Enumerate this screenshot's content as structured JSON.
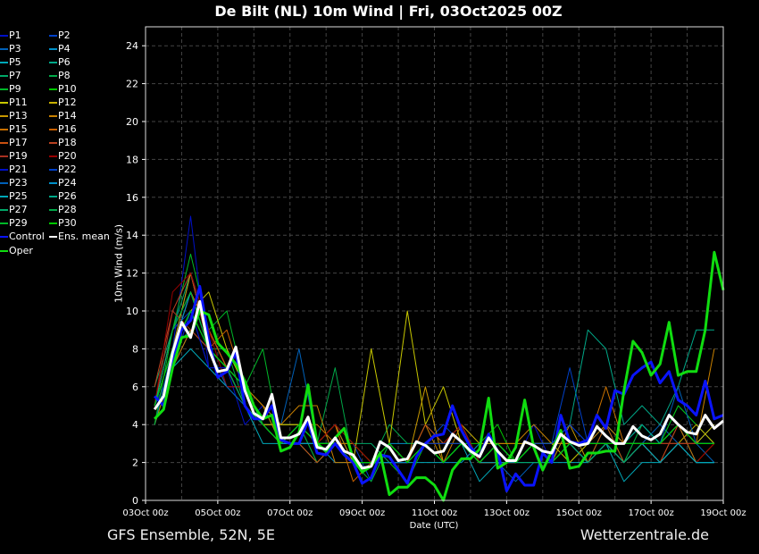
{
  "chart_data": {
    "type": "line",
    "title": "De Bilt  (NL)  10m Wind | Fri, 03Oct2025 00Z",
    "xlabel": "Date (UTC)",
    "ylabel": "10m Wind (m/s)",
    "ylim": [
      0,
      25
    ],
    "yticks": [
      "0",
      "2",
      "4",
      "6",
      "8",
      "10",
      "12",
      "14",
      "16",
      "18",
      "20",
      "22",
      "24"
    ],
    "xlim_hours": [
      0,
      384
    ],
    "xticks": [
      "03Oct 00z",
      "05Oct 00z",
      "07Oct 00z",
      "09Oct 00z",
      "11Oct 00z",
      "13Oct 00z",
      "15Oct 00z",
      "17Oct 00z",
      "19Oct 00z"
    ],
    "grid": true,
    "legend_position": "left-outside",
    "step_hours_main": 6,
    "step_hours_members": 12,
    "highlight_series": [
      {
        "name": "Control",
        "color": "#0a14ff",
        "values": [
          5.5,
          5.0,
          7.5,
          9.0,
          9.5,
          11.3,
          8.5,
          6.5,
          6.8,
          7.8,
          5.0,
          4.3,
          4.3,
          5.0,
          3.2,
          3.0,
          3.0,
          4.2,
          2.5,
          2.4,
          3.0,
          2.4,
          2.0,
          0.9,
          1.2,
          2.4,
          2.3,
          1.6,
          0.9,
          2.3,
          3.0,
          3.4,
          3.5,
          5.0,
          3.7,
          2.8,
          2.3,
          3.5,
          2.6,
          0.5,
          1.4,
          0.8,
          0.8,
          2.5,
          2.0,
          4.5,
          3.1,
          3.0,
          3.2,
          4.5,
          3.8,
          5.8,
          5.6,
          6.6,
          7.0,
          7.3,
          6.2,
          6.8,
          5.3,
          5.0,
          4.5,
          6.3,
          4.3,
          4.5
        ]
      },
      {
        "name": "Oper",
        "color": "#10dd10",
        "values": [
          4.3,
          4.8,
          7.0,
          8.6,
          8.7,
          10.0,
          9.8,
          8.3,
          7.8,
          7.2,
          6.3,
          5.0,
          4.3,
          4.5,
          2.6,
          2.8,
          3.6,
          6.1,
          3.0,
          2.6,
          3.3,
          3.8,
          2.2,
          1.5,
          1.8,
          2.5,
          0.3,
          0.7,
          0.7,
          1.2,
          1.2,
          0.8,
          0.0,
          1.6,
          2.2,
          2.2,
          2.7,
          5.4,
          1.7,
          2.0,
          2.8,
          5.3,
          2.8,
          1.6,
          2.6,
          3.7,
          1.7,
          1.8,
          2.5,
          2.5,
          2.6,
          2.6,
          5.8,
          8.4,
          7.8,
          6.6,
          7.2,
          9.4,
          6.6,
          6.8,
          6.8,
          9.0,
          13.1,
          11.1
        ]
      },
      {
        "name": "Ens. mean",
        "color": "#ffffff",
        "values": [
          4.8,
          5.5,
          7.8,
          9.4,
          8.6,
          10.5,
          8.0,
          6.8,
          6.9,
          8.1,
          5.8,
          4.6,
          4.3,
          5.6,
          3.3,
          3.3,
          3.5,
          4.4,
          2.8,
          2.7,
          3.3,
          2.6,
          2.4,
          1.7,
          1.8,
          3.1,
          2.8,
          2.1,
          2.2,
          3.1,
          2.9,
          2.5,
          2.6,
          3.5,
          3.1,
          2.6,
          2.3,
          3.3,
          2.6,
          2.1,
          2.1,
          3.1,
          2.9,
          2.6,
          2.5,
          3.5,
          3.1,
          2.9,
          3.0,
          3.9,
          3.4,
          3.0,
          3.0,
          3.9,
          3.4,
          3.2,
          3.5,
          4.5,
          4.0,
          3.6,
          3.5,
          4.5,
          3.8,
          4.2
        ]
      }
    ],
    "members": [
      {
        "name": "P1",
        "color": "#0010c8",
        "values": [
          5,
          8,
          15,
          7,
          7,
          4,
          5,
          3,
          4,
          3,
          4,
          2,
          2,
          3,
          2,
          3,
          3,
          4,
          2,
          3,
          2,
          4,
          2,
          4,
          3,
          3,
          2,
          3,
          3,
          4,
          3,
          4
        ]
      },
      {
        "name": "P2",
        "color": "#0040c8",
        "values": [
          5,
          9,
          10,
          7,
          6,
          6,
          4,
          3,
          4,
          2,
          3,
          3,
          1,
          3,
          2,
          3,
          4,
          3,
          2,
          2,
          2,
          3,
          3,
          7,
          3,
          3,
          2,
          4,
          3,
          5,
          4,
          3
        ]
      },
      {
        "name": "P3",
        "color": "#0060b8",
        "values": [
          4,
          7,
          9,
          8,
          7,
          5,
          4,
          4,
          8,
          3,
          3,
          2,
          2,
          2,
          2,
          4,
          3,
          4,
          2,
          2,
          1,
          2,
          2,
          3,
          2,
          4,
          2,
          3,
          4,
          3,
          3,
          2
        ]
      },
      {
        "name": "P4",
        "color": "#0090c8",
        "values": [
          5,
          8,
          12,
          9,
          7,
          6,
          4,
          3,
          4,
          3,
          2,
          2,
          2,
          3,
          3,
          3,
          2,
          2,
          3,
          3,
          2,
          3,
          2,
          3,
          3,
          4,
          3,
          4,
          3,
          4,
          2,
          2
        ]
      },
      {
        "name": "P5",
        "color": "#00a8b8",
        "values": [
          5,
          7,
          8,
          7,
          6,
          5,
          3,
          3,
          3,
          2,
          3,
          2,
          2,
          2,
          2,
          2,
          2,
          3,
          1,
          2,
          2,
          2,
          2,
          2,
          2,
          3,
          1,
          2,
          2,
          3,
          2,
          2
        ]
      },
      {
        "name": "P6",
        "color": "#00a888",
        "values": [
          5,
          8,
          9,
          8,
          7,
          6,
          4,
          4,
          4,
          3,
          3,
          2,
          2,
          3,
          2,
          3,
          2,
          3,
          2,
          3,
          2,
          3,
          3,
          4,
          9,
          8,
          4,
          5,
          4,
          6,
          9,
          9
        ]
      },
      {
        "name": "P7",
        "color": "#00a868",
        "values": [
          6,
          9,
          12,
          8,
          7,
          6,
          5,
          4,
          4,
          3,
          4,
          3,
          3,
          2,
          2,
          3,
          3,
          3,
          2,
          2,
          2,
          2,
          2,
          3,
          3,
          3,
          3,
          3,
          2,
          3,
          2,
          2
        ]
      },
      {
        "name": "P8",
        "color": "#00a848",
        "values": [
          4,
          7,
          10,
          8,
          8,
          5,
          4,
          3,
          3,
          3,
          7,
          2,
          2,
          4,
          3,
          3,
          2,
          3,
          2,
          2,
          2,
          3,
          2,
          3,
          2,
          3,
          2,
          3,
          3,
          4,
          3,
          3
        ]
      },
      {
        "name": "P9",
        "color": "#00b828",
        "values": [
          5,
          9,
          13,
          9,
          10,
          6,
          8,
          3,
          4,
          2,
          3,
          2,
          1,
          3,
          2,
          3,
          3,
          3,
          2,
          3,
          2,
          3,
          3,
          3,
          2,
          4,
          2,
          4,
          3,
          4,
          3,
          3
        ]
      },
      {
        "name": "P10",
        "color": "#00c800",
        "values": [
          4,
          8,
          11,
          8,
          7,
          6,
          5,
          3,
          3,
          3,
          3,
          3,
          2,
          2,
          1,
          3,
          2,
          3,
          3,
          4,
          2,
          3,
          2,
          3,
          3,
          3,
          3,
          4,
          3,
          5,
          4,
          3
        ]
      },
      {
        "name": "P11",
        "color": "#c8c800",
        "values": [
          5,
          8,
          10,
          11,
          8,
          6,
          4,
          4,
          4,
          3,
          3,
          2,
          8,
          3,
          10,
          4,
          6,
          3,
          2,
          2,
          2,
          3,
          3,
          2,
          3,
          3,
          3,
          3,
          2,
          3,
          3,
          4
        ]
      },
      {
        "name": "P12",
        "color": "#c8b000",
        "values": [
          5,
          8,
          11,
          9,
          7,
          5,
          4,
          4,
          4,
          3,
          3,
          2,
          2,
          3,
          2,
          3,
          3,
          4,
          3,
          3,
          3,
          3,
          3,
          3,
          3,
          3,
          3,
          3,
          3,
          3,
          4,
          3
        ]
      },
      {
        "name": "P13",
        "color": "#c89800",
        "values": [
          5,
          8,
          12,
          8,
          7,
          5,
          4,
          3,
          3,
          3,
          4,
          2,
          2,
          3,
          2,
          6,
          2,
          3,
          2,
          3,
          2,
          3,
          2,
          4,
          2,
          3,
          3,
          3,
          3,
          4,
          3,
          3
        ]
      },
      {
        "name": "P14",
        "color": "#c88000",
        "values": [
          4,
          7,
          9,
          8,
          7,
          6,
          5,
          4,
          5,
          5,
          2,
          2,
          2,
          2,
          2,
          4,
          2,
          4,
          2,
          3,
          3,
          4,
          3,
          3,
          3,
          4,
          3,
          3,
          3,
          4,
          3,
          8
        ]
      },
      {
        "name": "P15",
        "color": "#c87000",
        "values": [
          5,
          9,
          11,
          9,
          7,
          6,
          5,
          3,
          4,
          4,
          3,
          3,
          2,
          3,
          2,
          3,
          3,
          4,
          2,
          3,
          2,
          3,
          2,
          3,
          3,
          6,
          3,
          3,
          2,
          4,
          2,
          3
        ]
      },
      {
        "name": "P16",
        "color": "#c86000",
        "values": [
          5,
          8,
          10,
          8,
          9,
          6,
          4,
          3,
          4,
          3,
          4,
          1,
          2,
          3,
          2,
          3,
          2,
          3,
          2,
          3,
          2,
          3,
          2,
          3,
          2,
          3,
          2,
          3,
          3,
          3,
          3,
          3
        ]
      },
      {
        "name": "P17",
        "color": "#c85010",
        "values": [
          5,
          8,
          11,
          9,
          7,
          5,
          4,
          3,
          3,
          2,
          3,
          2,
          2,
          3,
          2,
          4,
          3,
          3,
          2,
          2,
          2,
          3,
          2,
          3,
          2,
          4,
          2,
          3,
          3,
          4,
          3,
          3
        ]
      },
      {
        "name": "P18",
        "color": "#b84020",
        "values": [
          6,
          10,
          12,
          8,
          6,
          6,
          4,
          3,
          4,
          3,
          3,
          2,
          2,
          3,
          2,
          3,
          2,
          3,
          2,
          3,
          2,
          3,
          2,
          3,
          3,
          3,
          3,
          3,
          2,
          4,
          3,
          3
        ]
      },
      {
        "name": "P19",
        "color": "#a83020",
        "values": [
          5,
          10,
          9,
          8,
          7,
          6,
          4,
          3,
          3,
          3,
          3,
          2,
          2,
          2,
          2,
          3,
          2,
          3,
          2,
          3,
          2,
          3,
          2,
          3,
          2,
          3,
          2,
          3,
          3,
          3,
          3,
          3
        ]
      },
      {
        "name": "P20",
        "color": "#980000",
        "values": [
          5,
          11,
          12,
          9,
          6,
          6,
          4,
          3,
          4,
          3,
          4,
          3,
          2,
          3,
          2,
          3,
          3,
          4,
          2,
          2,
          2,
          3,
          2,
          3,
          3,
          3,
          2,
          3,
          2,
          3,
          2,
          3
        ]
      },
      {
        "name": "P21",
        "color": "#0010c8",
        "values": [
          5,
          7,
          10,
          7,
          7,
          5,
          4,
          3,
          3,
          3,
          3,
          2,
          2,
          3,
          2,
          3,
          2,
          3,
          2,
          3,
          2,
          3,
          2,
          3,
          3,
          3,
          3,
          3,
          3,
          4,
          3,
          3
        ]
      },
      {
        "name": "P22",
        "color": "#0040c8",
        "values": [
          5,
          8,
          11,
          8,
          7,
          6,
          4,
          3,
          4,
          3,
          3,
          2,
          2,
          2,
          2,
          3,
          3,
          3,
          2,
          3,
          2,
          3,
          3,
          4,
          3,
          3,
          3,
          4,
          3,
          4,
          3,
          3
        ]
      },
      {
        "name": "P23",
        "color": "#0060b8",
        "values": [
          4,
          8,
          10,
          8,
          6,
          5,
          4,
          3,
          3,
          3,
          3,
          2,
          2,
          3,
          2,
          3,
          2,
          3,
          2,
          3,
          2,
          3,
          2,
          3,
          2,
          3,
          3,
          3,
          3,
          6,
          3,
          3
        ]
      },
      {
        "name": "P24",
        "color": "#0090c8",
        "values": [
          5,
          8,
          11,
          8,
          7,
          6,
          4,
          3,
          4,
          3,
          3,
          2,
          2,
          2,
          2,
          3,
          2,
          3,
          2,
          3,
          2,
          3,
          2,
          3,
          2,
          3,
          2,
          3,
          2,
          3,
          2,
          2
        ]
      },
      {
        "name": "P25",
        "color": "#00a8b8",
        "values": [
          5,
          8,
          10,
          8,
          7,
          5,
          4,
          3,
          3,
          3,
          3,
          2,
          2,
          3,
          2,
          3,
          2,
          3,
          2,
          2,
          2,
          3,
          2,
          3,
          2,
          3,
          2,
          3,
          2,
          3,
          2,
          2
        ]
      },
      {
        "name": "P26",
        "color": "#00a888",
        "values": [
          5,
          9,
          11,
          8,
          7,
          6,
          4,
          3,
          4,
          3,
          3,
          2,
          2,
          3,
          2,
          3,
          2,
          3,
          2,
          3,
          2,
          3,
          2,
          3,
          3,
          3,
          3,
          4,
          3,
          4,
          3,
          3
        ]
      },
      {
        "name": "P27",
        "color": "#00a868",
        "values": [
          5,
          8,
          10,
          8,
          7,
          6,
          4,
          3,
          4,
          3,
          3,
          2,
          2,
          3,
          2,
          3,
          2,
          3,
          2,
          3,
          2,
          3,
          2,
          3,
          2,
          3,
          2,
          3,
          3,
          4,
          3,
          3
        ]
      },
      {
        "name": "P28",
        "color": "#00a848",
        "values": [
          5,
          8,
          10,
          8,
          7,
          5,
          4,
          3,
          4,
          3,
          3,
          2,
          2,
          3,
          2,
          3,
          2,
          3,
          2,
          3,
          2,
          3,
          2,
          3,
          3,
          3,
          3,
          3,
          3,
          4,
          3,
          3
        ]
      },
      {
        "name": "P29",
        "color": "#00b828",
        "values": [
          4,
          9,
          11,
          8,
          7,
          6,
          4,
          3,
          4,
          3,
          3,
          2,
          2,
          3,
          2,
          3,
          2,
          3,
          2,
          3,
          2,
          3,
          2,
          3,
          3,
          3,
          3,
          3,
          3,
          4,
          3,
          3
        ]
      },
      {
        "name": "P30",
        "color": "#00c800",
        "values": [
          5,
          8,
          10,
          8,
          7,
          6,
          4,
          3,
          4,
          3,
          3,
          2,
          2,
          3,
          2,
          3,
          2,
          3,
          2,
          3,
          2,
          3,
          2,
          3,
          3,
          3,
          3,
          3,
          3,
          4,
          3,
          3
        ]
      }
    ]
  },
  "legend": {
    "items": [
      "P1",
      "P2",
      "P3",
      "P4",
      "P5",
      "P6",
      "P7",
      "P8",
      "P9",
      "P10",
      "P11",
      "P12",
      "P13",
      "P14",
      "P15",
      "P16",
      "P17",
      "P18",
      "P19",
      "P20",
      "P21",
      "P22",
      "P23",
      "P24",
      "P25",
      "P26",
      "P27",
      "P28",
      "P29",
      "P30",
      "Control",
      "Ens. mean",
      "Oper"
    ]
  },
  "footer": {
    "left": "GFS Ensemble, 52N, 5E",
    "right": "Wetterzentrale.de"
  }
}
